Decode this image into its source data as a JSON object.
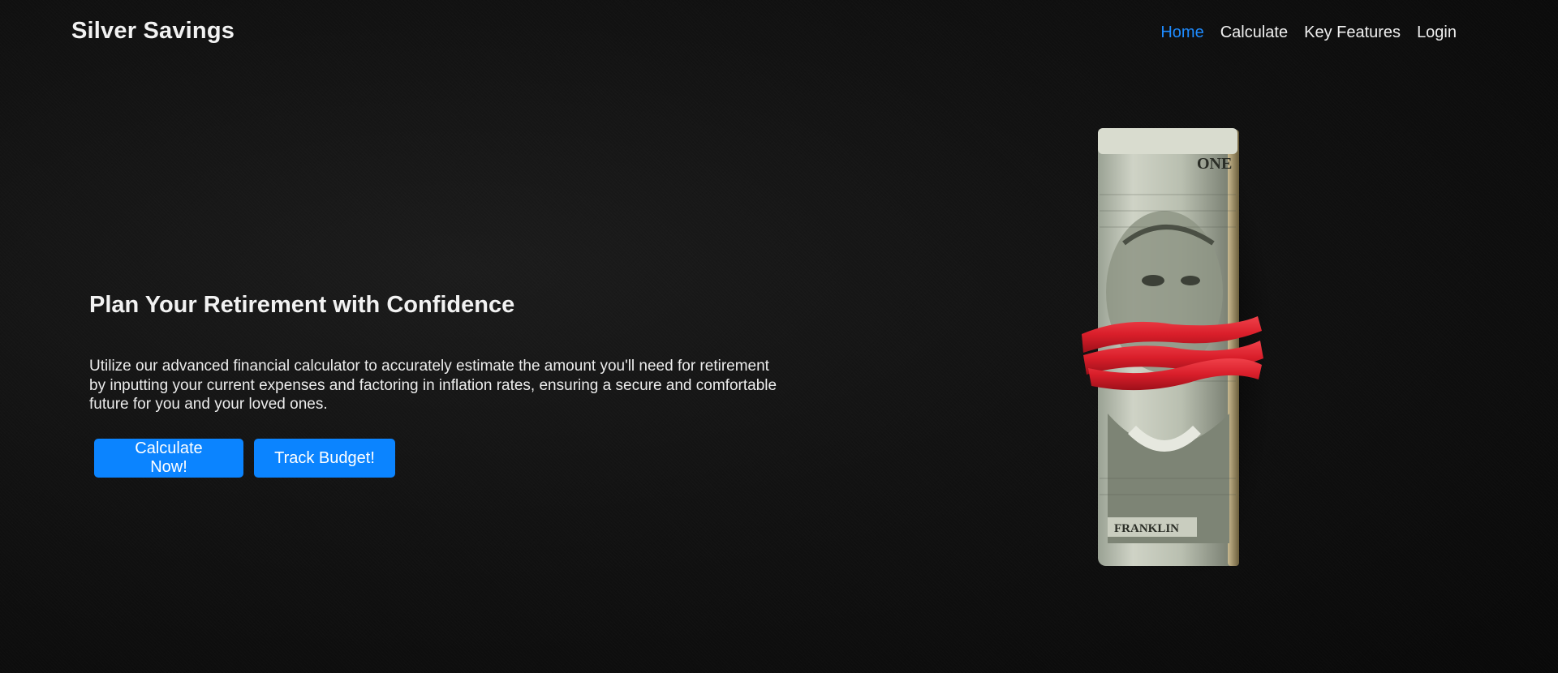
{
  "header": {
    "brand": "Silver Savings",
    "nav": [
      {
        "label": "Home",
        "active": true
      },
      {
        "label": "Calculate",
        "active": false
      },
      {
        "label": "Key Features",
        "active": false
      },
      {
        "label": "Login",
        "active": false
      }
    ]
  },
  "hero": {
    "title": "Plan Your Retirement with Confidence",
    "description": "Utilize our advanced financial calculator to accurately estimate the amount you'll need for retirement by inputting your current expenses and factoring in inflation rates, ensuring a secure and comfortable future for you and your loved ones.",
    "buttons": {
      "calculate": "Calculate Now!",
      "budget": "Track Budget!"
    }
  },
  "image": {
    "bill_text_top": "ONE",
    "bill_text_bottom": "FRANKLIN"
  },
  "colors": {
    "accent": "#0b84ff",
    "active_link": "#1e8bff",
    "background": "#0c0c0c",
    "band": "#e0232e"
  }
}
